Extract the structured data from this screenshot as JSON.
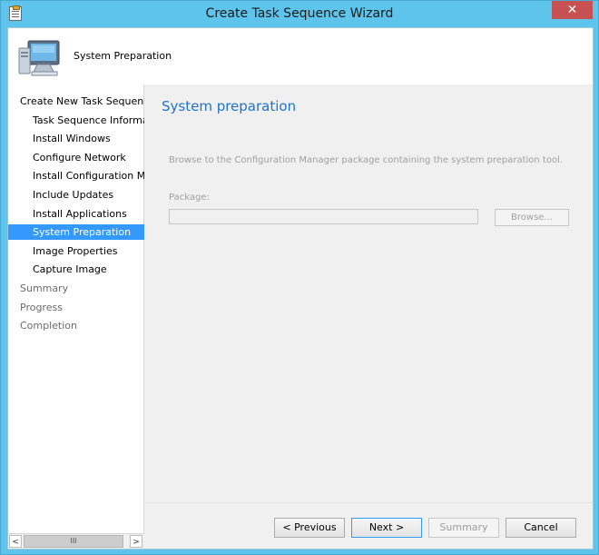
{
  "window": {
    "title": "Create Task Sequence Wizard",
    "close_glyph": "✕"
  },
  "banner": {
    "title": "System Preparation",
    "icon": "computer-icon"
  },
  "nav": {
    "items": [
      {
        "label": "Create New Task Sequence",
        "level": "top",
        "state": "normal"
      },
      {
        "label": "Task Sequence Information",
        "level": "sub",
        "state": "normal"
      },
      {
        "label": "Install Windows",
        "level": "sub",
        "state": "normal"
      },
      {
        "label": "Configure Network",
        "level": "sub",
        "state": "normal"
      },
      {
        "label": "Install Configuration Manager",
        "level": "sub",
        "state": "normal"
      },
      {
        "label": "Include Updates",
        "level": "sub",
        "state": "normal"
      },
      {
        "label": "Install Applications",
        "level": "sub",
        "state": "normal"
      },
      {
        "label": "System Preparation",
        "level": "sub",
        "state": "selected"
      },
      {
        "label": "Image Properties",
        "level": "sub",
        "state": "normal"
      },
      {
        "label": "Capture Image",
        "level": "sub",
        "state": "normal"
      },
      {
        "label": "Summary",
        "level": "top",
        "state": "grey"
      },
      {
        "label": "Progress",
        "level": "top",
        "state": "grey"
      },
      {
        "label": "Completion",
        "level": "top",
        "state": "grey"
      }
    ],
    "scroll": {
      "left_arrow": "<",
      "right_arrow": ">",
      "thumb_grip": "III"
    }
  },
  "content": {
    "heading": "System preparation",
    "description": "Browse to the Configuration Manager package containing the system preparation tool.",
    "package_label": "Package:",
    "package_value": "",
    "browse_label": "Browse..."
  },
  "buttons": {
    "previous": "< Previous",
    "next": "Next >",
    "summary": "Summary",
    "cancel": "Cancel"
  },
  "colors": {
    "accent": "#1e73c8",
    "selection": "#3399ff",
    "titlebar": "#5fc4eb",
    "close": "#c75050"
  }
}
